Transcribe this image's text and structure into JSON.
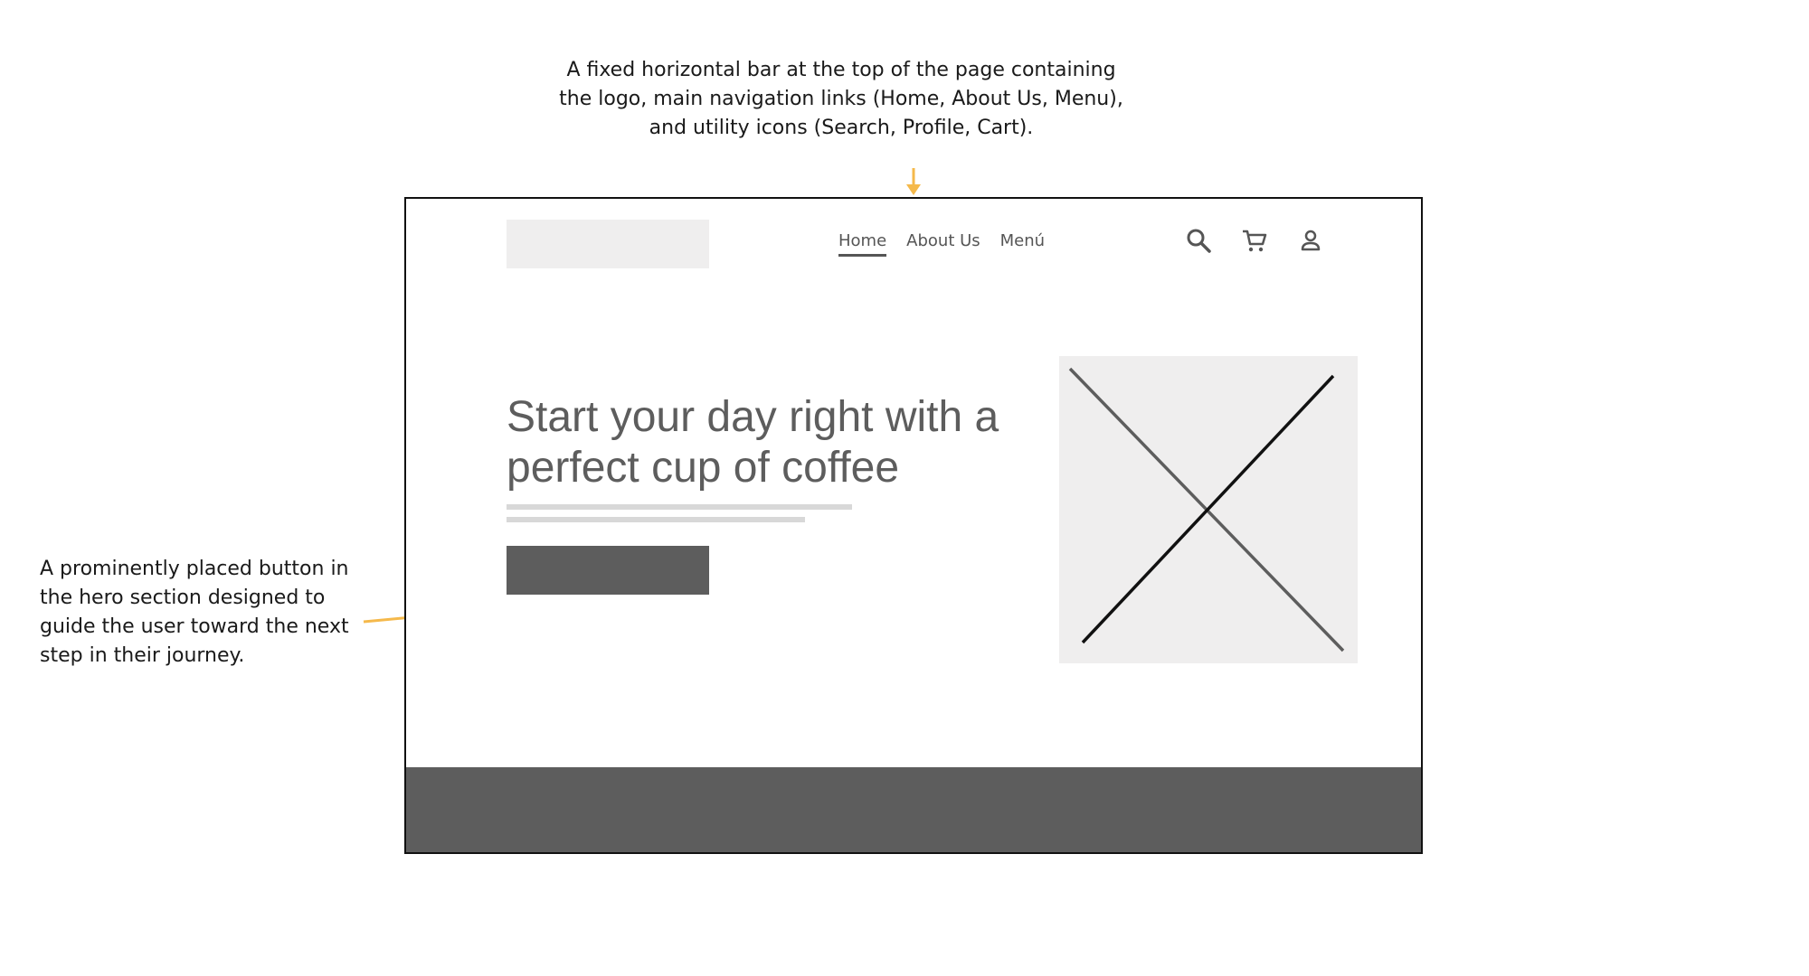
{
  "annotations": {
    "navbar_note": "A fixed horizontal bar at the top of the page containing the logo, main navigation links (Home, About Us, Menu), and utility icons (Search, Profile, Cart).",
    "cta_note": "A prominently placed button in the hero section designed to guide the user toward the next step in their journey."
  },
  "wireframe": {
    "nav": {
      "links": [
        {
          "label": "Home",
          "active": true
        },
        {
          "label": "About Us",
          "active": false
        },
        {
          "label": "Menú",
          "active": false
        }
      ]
    },
    "icons": [
      "search-icon",
      "cart-icon",
      "profile-icon"
    ],
    "hero": {
      "headline": "Start your day right with a perfect cup of coffee"
    }
  },
  "colors": {
    "accent_arrow": "#f5b94b",
    "placeholder_fill": "#efeeee",
    "dark_fill": "#5d5d5d",
    "text_gray": "#5d5d5d"
  }
}
